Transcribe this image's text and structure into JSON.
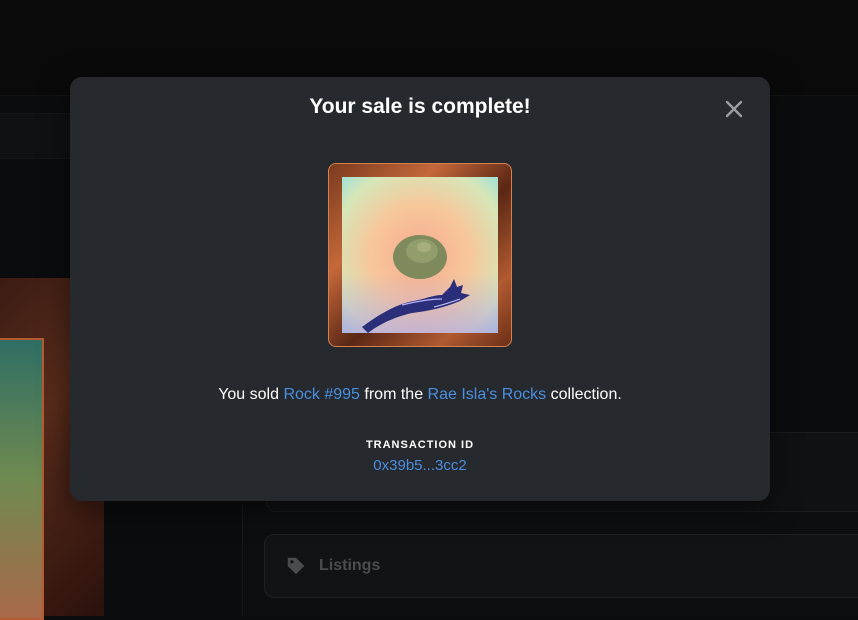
{
  "background": {
    "listings_label": "Listings"
  },
  "modal": {
    "title": "Your sale is complete!",
    "message": {
      "prefix": "You sold ",
      "item_name": "Rock #995",
      "middle": " from the ",
      "collection_name": "Rae Isla's Rocks",
      "suffix": " collection."
    },
    "transaction": {
      "label": "TRANSACTION ID",
      "value": "0x39b5...3cc2"
    }
  },
  "colors": {
    "modal_bg": "#26292e",
    "link": "#4b8fe0",
    "text": "#ffffff"
  },
  "icons": {
    "close": "close-icon",
    "tag": "tag-icon"
  }
}
